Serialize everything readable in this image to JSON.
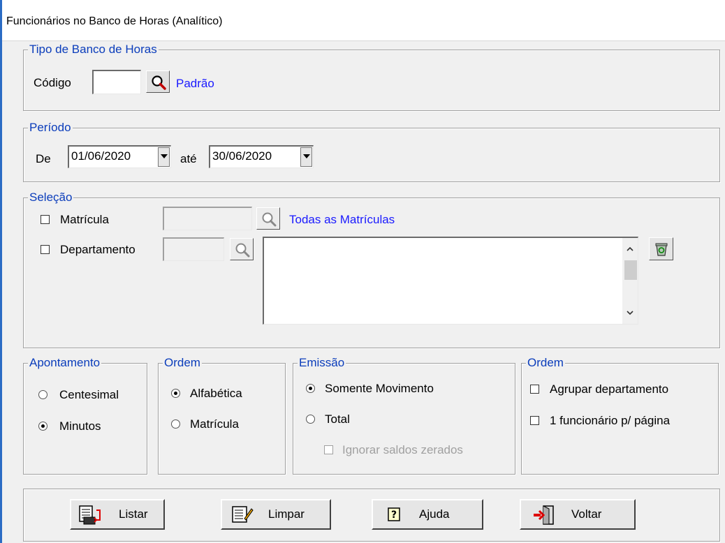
{
  "window": {
    "title": "Funcionários no Banco de Horas (Analítico)"
  },
  "tipo_banco": {
    "legend": "Tipo de Banco de Horas",
    "codigo_label": "Código",
    "codigo_value": "",
    "description": "Padrão"
  },
  "periodo": {
    "legend": "Período",
    "de_label": "De",
    "de_value": "01/06/2020",
    "ate_label": "até",
    "ate_value": "30/06/2020"
  },
  "selecao": {
    "legend": "Seleção",
    "matricula_label": "Matrícula",
    "matricula_checked": false,
    "matricula_description": "Todas as Matrículas",
    "departamento_label": "Departamento",
    "departamento_checked": false
  },
  "apontamento": {
    "legend": "Apontamento",
    "options": [
      "Centesimal",
      "Minutos"
    ],
    "selected": "Minutos"
  },
  "ordem": {
    "legend": "Ordem",
    "options": [
      "Alfabética",
      "Matrícula"
    ],
    "selected": "Alfabética"
  },
  "emissao": {
    "legend": "Emissão",
    "options": [
      "Somente Movimento",
      "Total"
    ],
    "selected": "Somente Movimento",
    "ignorar_label": "Ignorar saldos zerados",
    "ignorar_enabled": false
  },
  "ordem2": {
    "legend": "Ordem",
    "agrupar_label": "Agrupar departamento",
    "um_func_label": "1 funcionário p/ página"
  },
  "actions": {
    "listar": "Listar",
    "limpar": "Limpar",
    "ajuda": "Ajuda",
    "voltar": "Voltar"
  },
  "colors": {
    "legend": "#0b3dbb",
    "link": "#1a1aff",
    "window_bg": "#f0f0f0"
  }
}
